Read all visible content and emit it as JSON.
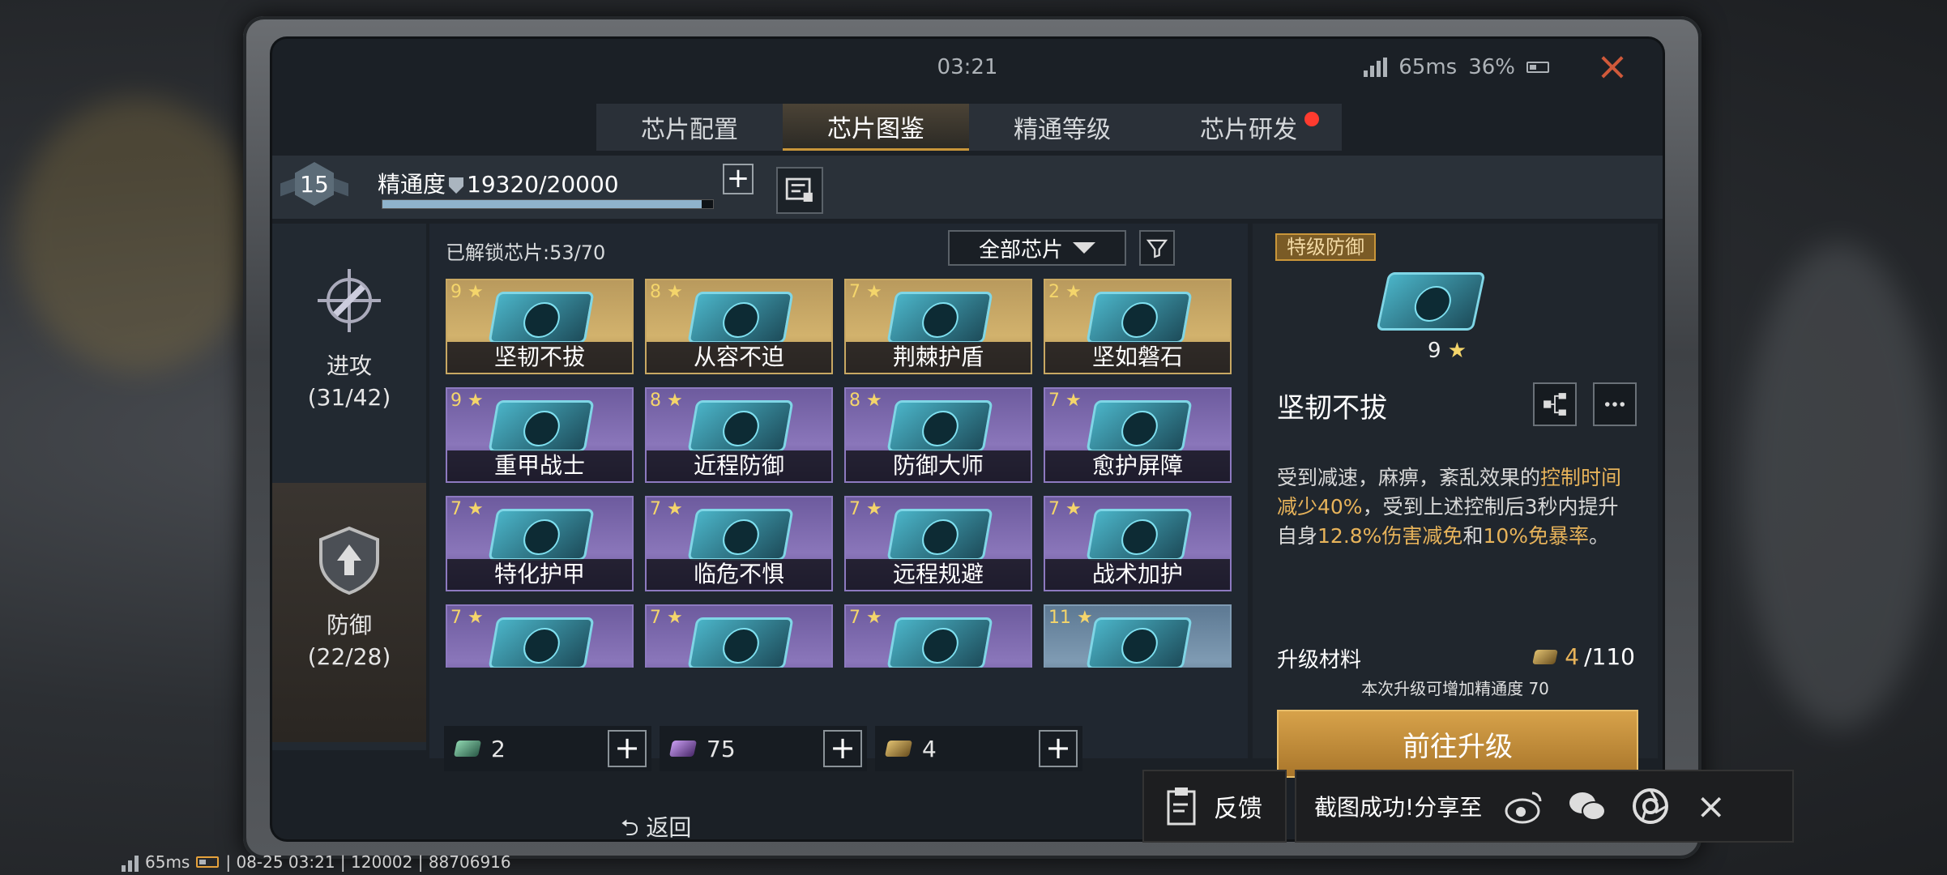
{
  "status": {
    "time": "03:21",
    "ping": "65ms",
    "battery": "36%"
  },
  "tabs": [
    "芯片配置",
    "芯片图鉴",
    "精通等级",
    "芯片研发"
  ],
  "header": {
    "level": "15",
    "mastery_label": "精通度",
    "mastery_value": "19320/20000",
    "mastery_progress": 0.966
  },
  "sidebar": [
    {
      "name": "进攻",
      "count": "(31/42)"
    },
    {
      "name": "防御",
      "count": "(22/28)"
    }
  ],
  "grid": {
    "unlocked": "已解锁芯片:53/70",
    "filter": "全部芯片",
    "cards": [
      {
        "name": "坚韧不拔",
        "stars": "9",
        "rarity": "gold"
      },
      {
        "name": "从容不迫",
        "stars": "8",
        "rarity": "gold"
      },
      {
        "name": "荆棘护盾",
        "stars": "7",
        "rarity": "gold"
      },
      {
        "name": "坚如磐石",
        "stars": "2",
        "rarity": "gold"
      },
      {
        "name": "重甲战士",
        "stars": "9",
        "rarity": "purple"
      },
      {
        "name": "近程防御",
        "stars": "8",
        "rarity": "purple"
      },
      {
        "name": "防御大师",
        "stars": "8",
        "rarity": "purple"
      },
      {
        "name": "愈护屏障",
        "stars": "7",
        "rarity": "purple"
      },
      {
        "name": "特化护甲",
        "stars": "7",
        "rarity": "purple"
      },
      {
        "name": "临危不惧",
        "stars": "7",
        "rarity": "purple"
      },
      {
        "name": "远程规避",
        "stars": "7",
        "rarity": "purple"
      },
      {
        "name": "战术加护",
        "stars": "7",
        "rarity": "purple"
      },
      {
        "name": "",
        "stars": "7",
        "rarity": "purple"
      },
      {
        "name": "",
        "stars": "7",
        "rarity": "purple"
      },
      {
        "name": "",
        "stars": "7",
        "rarity": "purple"
      },
      {
        "name": "",
        "stars": "11",
        "rarity": "blue"
      }
    ]
  },
  "materials": [
    "2",
    "75",
    "4"
  ],
  "detail": {
    "grade": "特级防御",
    "stars": "9",
    "name": "坚韧不拔",
    "desc": [
      "受到减速，麻痹，紊乱效果的",
      "控制时间减少40%",
      "，受到上述控制后3秒内提升自身",
      "12.8%伤害减免",
      "和",
      "10%免暴率",
      "。"
    ],
    "upgrade_label": "升级材料",
    "upgrade_owned": "4",
    "upgrade_required": "/110",
    "upgrade_note": "本次升级可增加精通度 70",
    "upgrade_button": "前往升级"
  },
  "footer": {
    "back": "返回"
  },
  "overlay": {
    "feedback": "反馈",
    "share_text": "截图成功!分享至"
  },
  "debug": {
    "ping": "65ms",
    "text": "| 08-25 03:21 | 120002 | 88706916"
  },
  "colors": {
    "accent_gold": "#c9963a",
    "highlight": "#e7b35a",
    "notification": "#ff3b2f"
  }
}
